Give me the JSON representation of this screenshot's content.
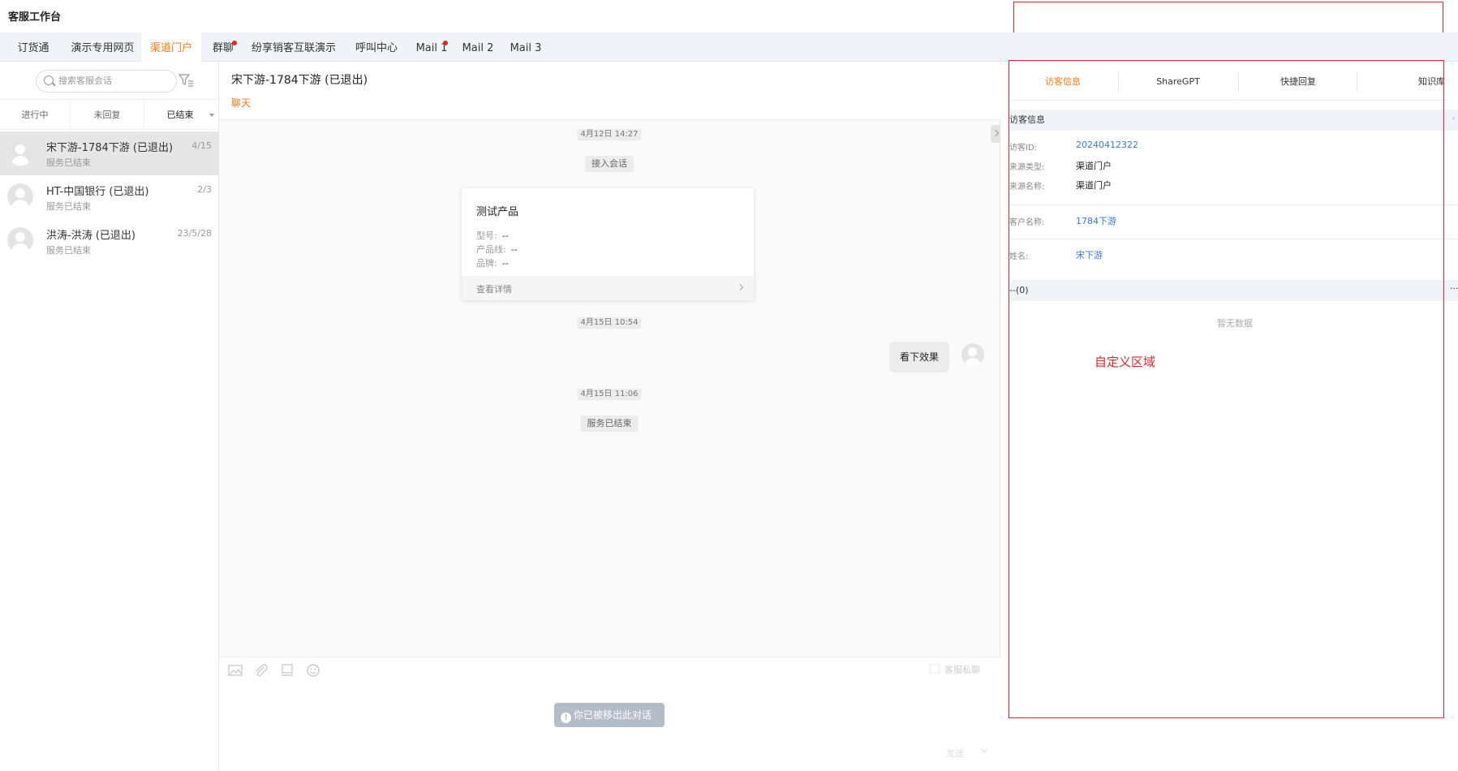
{
  "app": {
    "title": "客服工作台"
  },
  "tabs": [
    {
      "label": "订货通"
    },
    {
      "label": "演示专用网页"
    },
    {
      "label": "渠道门户"
    },
    {
      "label": "群聊"
    },
    {
      "label": "纷享销客互联演示"
    },
    {
      "label": "呼叫中心"
    },
    {
      "label": "Mail 1"
    },
    {
      "label": "Mail 2"
    },
    {
      "label": "Mail 3"
    }
  ],
  "colors": {
    "accent": "#f57c1c",
    "alert": "#e0252b",
    "link": "#3a7bd5"
  },
  "sidebar": {
    "search_placeholder": "搜索客服会话",
    "status_tabs": [
      "进行中",
      "未回复",
      "已结束"
    ],
    "conversations": [
      {
        "name": "宋下游-1784下游 (已退出)",
        "status": "服务已结束",
        "count": "4/15"
      },
      {
        "name": "HT-中国银行 (已退出)",
        "status": "服务已结束",
        "count": "2/3"
      },
      {
        "name": "洪涛-洪涛 (已退出)",
        "status": "服务已结束",
        "count": "23/5/28"
      }
    ]
  },
  "chat": {
    "title": "宋下游-1784下游 (已退出)",
    "tab": "聊天",
    "messages": {
      "time1": "4月12日 14:27",
      "sys1": "接入会话",
      "card": {
        "title": "测试产品",
        "rows": [
          {
            "label": "型号:",
            "value": "--"
          },
          {
            "label": "产品线:",
            "value": "--"
          },
          {
            "label": "品牌:",
            "value": "--"
          }
        ],
        "footer": "查看详情"
      },
      "time2": "4月15日 10:54",
      "bubble": "看下效果",
      "time3": "4月15日 11:06",
      "sys2": "服务已结束"
    },
    "composer": {
      "private_label": "客服私聊",
      "removed_notice": "你已被移出此对话",
      "send_label": "发送"
    }
  },
  "right_panel": {
    "tabs": [
      "访客信息",
      "ShareGPT",
      "快捷回复",
      "知识库"
    ],
    "section_visitor": "访客信息",
    "fields": [
      {
        "label": "访客ID:",
        "value": "20240412322",
        "link": true
      },
      {
        "label": "来源类型:",
        "value": "渠道门户",
        "link": false
      },
      {
        "label": "来源名称:",
        "value": "渠道门户",
        "link": false
      }
    ],
    "customer_label": "客户名称:",
    "customer_value": "1784下游",
    "name_label": "姓名:",
    "name_value": "宋下游",
    "section_count": "--(0)",
    "more": "···",
    "empty": "暂无数据",
    "custom_area": "自定义区域"
  }
}
